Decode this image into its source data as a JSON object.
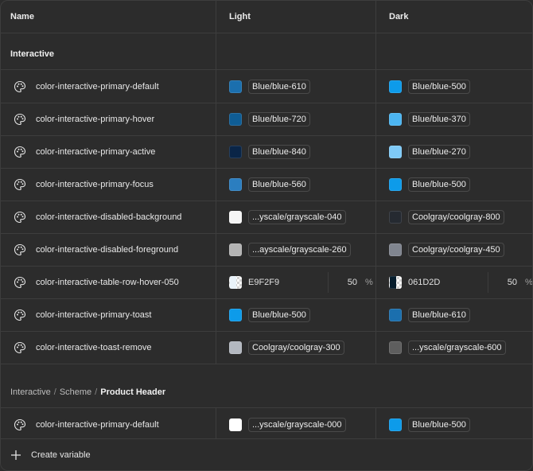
{
  "headers": {
    "name": "Name",
    "light": "Light",
    "dark": "Dark"
  },
  "group1": {
    "title": "Interactive"
  },
  "group2": {
    "crumb1": "Interactive",
    "sep": "/",
    "crumb2": "Scheme",
    "crumb3": "Product Header"
  },
  "rows": [
    {
      "name": "color-interactive-primary-default",
      "light": {
        "color": "#1b6fae",
        "label": "Blue/blue-610"
      },
      "dark": {
        "color": "#0d9bea",
        "label": "Blue/blue-500"
      }
    },
    {
      "name": "color-interactive-primary-hover",
      "light": {
        "color": "#0f5d95",
        "label": "Blue/blue-720"
      },
      "dark": {
        "color": "#4cb5f1",
        "label": "Blue/blue-370"
      }
    },
    {
      "name": "color-interactive-primary-active",
      "light": {
        "color": "#0a2547",
        "label": "Blue/blue-840"
      },
      "dark": {
        "color": "#7fcaf7",
        "label": "Blue/blue-270"
      }
    },
    {
      "name": "color-interactive-primary-focus",
      "light": {
        "color": "#2b7ec0",
        "label": "Blue/blue-560"
      },
      "dark": {
        "color": "#0d9bea",
        "label": "Blue/blue-500"
      }
    },
    {
      "name": "color-interactive-disabled-background",
      "light": {
        "color": "#f5f5f5",
        "label": "...yscale/grayscale-040"
      },
      "dark": {
        "color": "#252a31",
        "label": "Coolgray/coolgray-800"
      }
    },
    {
      "name": "color-interactive-disabled-foreground",
      "light": {
        "color": "#b4b4b4",
        "label": "...ayscale/grayscale-260"
      },
      "dark": {
        "color": "#80858f",
        "label": "Coolgray/coolgray-450"
      }
    },
    {
      "name": "color-interactive-table-row-hover-050",
      "light": {
        "color": "#E9F2F9",
        "hex": "E9F2F9",
        "percent": "50",
        "unit": "%"
      },
      "dark": {
        "color": "#061D2D",
        "hex": "061D2D",
        "percent": "50",
        "unit": "%"
      }
    },
    {
      "name": "color-interactive-primary-toast",
      "light": {
        "color": "#0d9bea",
        "label": "Blue/blue-500"
      },
      "dark": {
        "color": "#1b6fae",
        "label": "Blue/blue-610"
      }
    },
    {
      "name": "color-interactive-toast-remove",
      "light": {
        "color": "#b3b8c0",
        "label": "Coolgray/coolgray-300"
      },
      "dark": {
        "color": "#5e5e5e",
        "label": "...yscale/grayscale-600"
      }
    }
  ],
  "row_group2": {
    "name": "color-interactive-primary-default",
    "light": {
      "color": "#ffffff",
      "label": "...yscale/grayscale-000"
    },
    "dark": {
      "color": "#0d9bea",
      "label": "Blue/blue-500"
    }
  },
  "footer": {
    "label": "Create variable"
  },
  "icons": {
    "row_icon": "palette-icon",
    "footer_icon": "plus-icon"
  }
}
